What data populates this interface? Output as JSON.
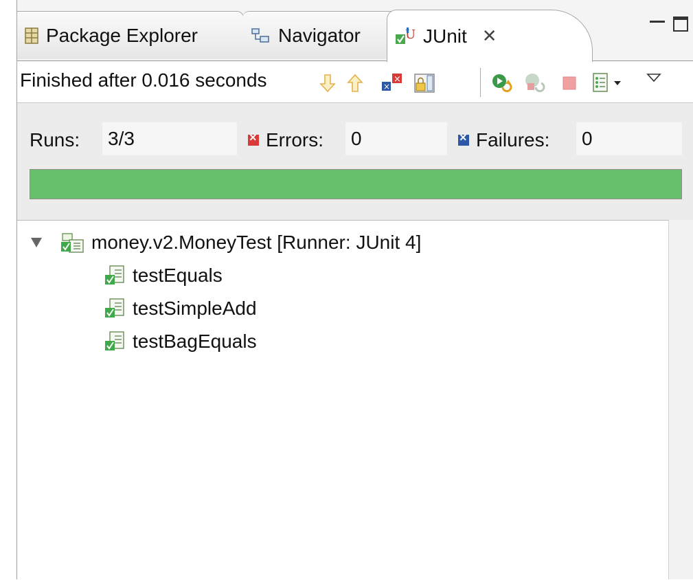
{
  "tabs": [
    {
      "label": "Package Explorer",
      "icon": "package-explorer-icon",
      "active": false
    },
    {
      "label": "Navigator",
      "icon": "navigator-icon",
      "active": false
    },
    {
      "label": "JUnit",
      "icon": "junit-icon",
      "active": true,
      "close_glyph": "✕"
    }
  ],
  "toolbar": {
    "status": "Finished after 0.016 seconds",
    "buttons": [
      "next-failure-icon",
      "previous-failure-icon",
      "show-failures-only-icon",
      "scroll-lock-icon",
      "rerun-test-icon",
      "rerun-failed-first-icon",
      "stop-icon",
      "test-run-history-icon",
      "view-menu-icon"
    ]
  },
  "counters": {
    "runs_label": "Runs:",
    "runs_value": "3/3",
    "errors_label": "Errors:",
    "errors_value": "0",
    "failures_label": "Failures:",
    "failures_value": "0"
  },
  "progress": {
    "fraction": 1.0,
    "color": "#67c06a"
  },
  "tree": {
    "suite": "money.v2.MoneyTest [Runner: JUnit 4]",
    "tests": [
      "testEquals",
      "testSimpleAdd",
      "testBagEquals"
    ]
  }
}
